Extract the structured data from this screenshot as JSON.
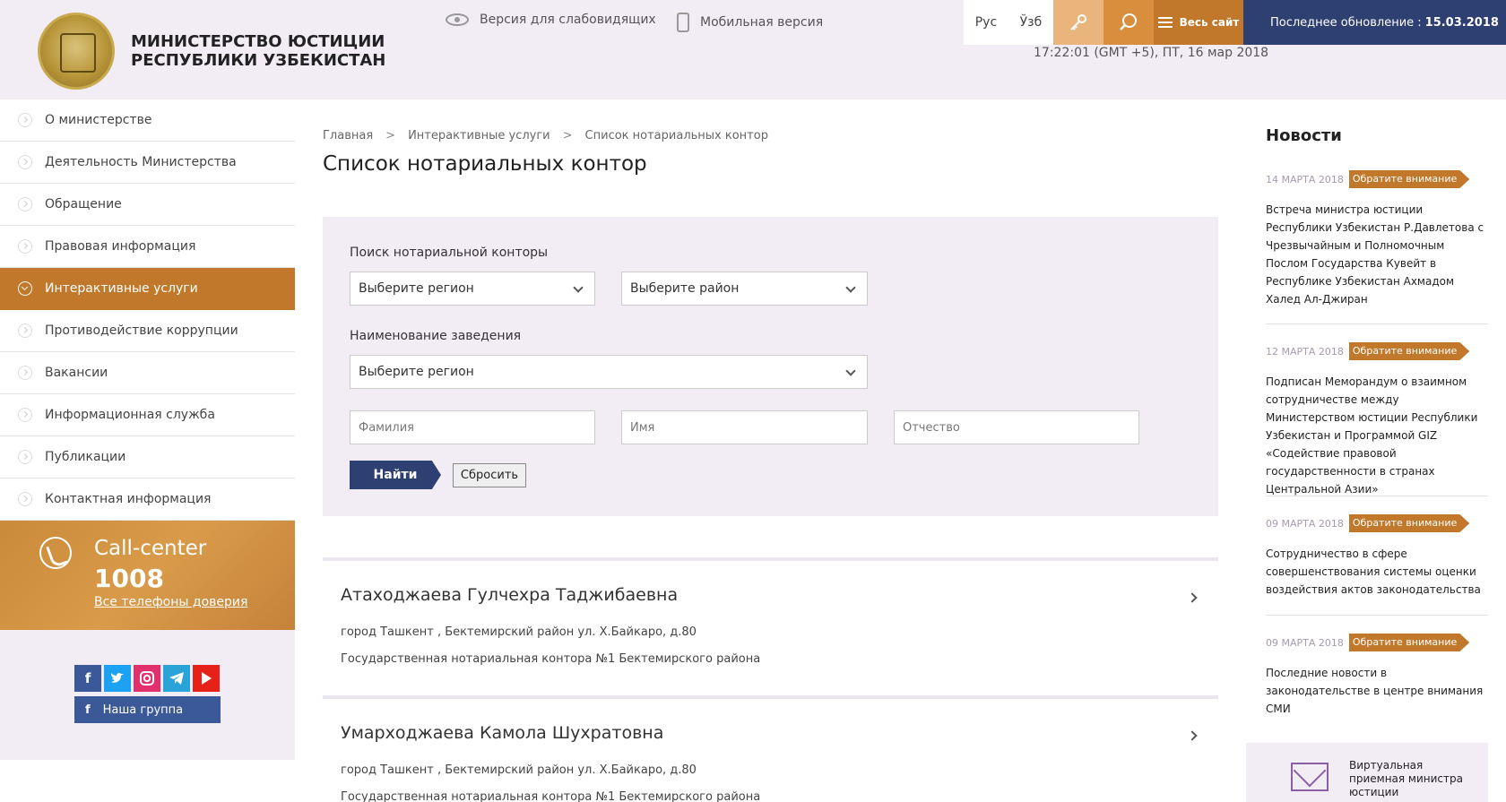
{
  "header": {
    "org_line1": "МИНИСТЕРСТВО ЮСТИЦИИ",
    "org_line2": "РЕСПУБЛИКИ УЗБЕКИСТАН",
    "accessibility_link": "Версия для слабовидящих",
    "mobile_link": "Мобильная версия",
    "lang_ru": "Рус",
    "lang_uz": "Ўзб",
    "all_site_label": "Весь сайт",
    "update_label": "Последнее обновление :",
    "update_date": "15.03.2018",
    "clock": "17:22:01 (GMT +5), ПТ, 16 мар 2018"
  },
  "sidebar": {
    "items": [
      {
        "label": "О министерстве"
      },
      {
        "label": "Деятельность Министерства"
      },
      {
        "label": "Обращение"
      },
      {
        "label": "Правовая информация"
      },
      {
        "label": "Интерактивные услуги"
      },
      {
        "label": "Противодействие коррупции"
      },
      {
        "label": "Вакансии"
      },
      {
        "label": "Информационная служба"
      },
      {
        "label": "Публикации"
      },
      {
        "label": "Контактная информация"
      }
    ],
    "active_index": 4,
    "callcenter": {
      "title": "Call-center",
      "number": "1008",
      "link": "Все телефоны доверия"
    },
    "social": {
      "fb": "f",
      "group_label": "Наша группа"
    }
  },
  "breadcrumb": {
    "items": [
      "Главная",
      "Интерактивные услуги",
      "Список нотариальных контор"
    ],
    "separator": ">"
  },
  "page_title": "Список нотариальных контор",
  "search": {
    "search_label": "Поиск нотариальной конторы",
    "region_select": "Выберите регион",
    "district_select": "Выберите район",
    "name_label": "Наименование заведения",
    "name_select": "Выберите регион",
    "surname_placeholder": "Фамилия",
    "firstname_placeholder": "Имя",
    "patronymic_placeholder": "Отчество",
    "find_button": "Найти",
    "reset_button": "Сбросить"
  },
  "results": [
    {
      "name": "Атаходжаева Гулчехра Таджибаевна",
      "address": "город Ташкент , Бектемирский район ул. Х.Байкаро, д.80",
      "office": "Государственная нотариальная контора №1 Бектемирского района"
    },
    {
      "name": "Умарходжаева Камола Шухратовна",
      "address": "город Ташкент , Бектемирский район ул. Х.Байкаро, д.80",
      "office": "Государственная нотариальная контора №1 Бектемирского района"
    }
  ],
  "news": {
    "heading": "Новости",
    "items": [
      {
        "date": "14 МАРТА 2018",
        "tag": "Обратите внимание",
        "text": "Встреча министра юстиции Республики Узбекистан Р.Давлетова с Чрезвычайным и Полномочным Послом Государства Кувейт в Республике Узбекистан Ахмадом Халед Ал-Джиран"
      },
      {
        "date": "12 МАРТА 2018",
        "tag": "Обратите внимание",
        "text": "Подписан Меморандум о взаимном сотрудничестве между Министерством юстиции Республики Узбекистан и Программой GIZ «Содействие правовой государственности в странах Центральной Азии»"
      },
      {
        "date": "09 МАРТА 2018",
        "tag": "Обратите внимание",
        "text": "Сотрудничество в сфере совершенствования системы оценки воздействия актов законодательства"
      },
      {
        "date": "09 МАРТА 2018",
        "tag": "Обратите внимание",
        "text": "Последние новости в законодательстве в центре внимания СМИ"
      }
    ],
    "virtual_reception": "Виртуальная приемная министра юстиции"
  },
  "colors": {
    "accent_orange": "#c1782b",
    "navy": "#2e3f72",
    "lavender_bg": "#f2ecf5"
  },
  "icons": [
    "eye-icon",
    "mobile-icon",
    "key-icon",
    "search-icon",
    "menu-icon",
    "phone-icon",
    "envelope-icon",
    "chevron-right-icon",
    "chevron-down-icon"
  ]
}
